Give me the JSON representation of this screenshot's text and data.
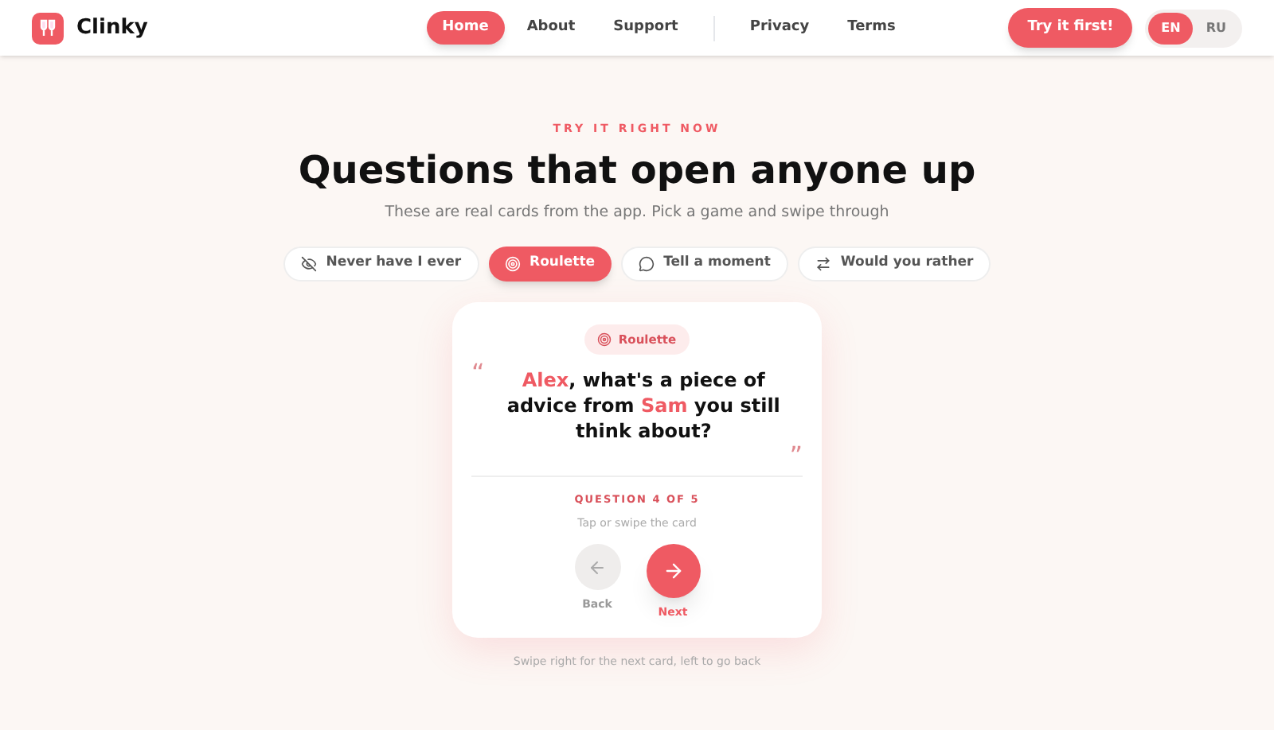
{
  "header": {
    "brand": "Clinky",
    "nav": [
      {
        "label": "Home",
        "selected": true
      },
      {
        "label": "About",
        "selected": false
      },
      {
        "label": "Support",
        "selected": false
      },
      {
        "label": "Privacy",
        "selected": false
      },
      {
        "label": "Terms",
        "selected": false
      }
    ],
    "cta": "Try it first!",
    "languages": [
      {
        "label": "EN",
        "selected": true
      },
      {
        "label": "RU",
        "selected": false
      }
    ]
  },
  "hero": {
    "eyebrow": "TRY IT RIGHT NOW",
    "title": "Questions that open anyone up",
    "subtitle": "These are real cards from the app. Pick a game and swipe through"
  },
  "games": [
    {
      "label": "Never have I ever",
      "kind": "eye-off",
      "selected": false
    },
    {
      "label": "Roulette",
      "kind": "target",
      "selected": true
    },
    {
      "label": "Tell a moment",
      "kind": "chat",
      "selected": false
    },
    {
      "label": "Would you rather",
      "kind": "swap",
      "selected": false
    }
  ],
  "card": {
    "badge": "Roulette",
    "open_quote": "“",
    "close_quote": "”",
    "question": [
      {
        "kind": "name",
        "text": "Alex"
      },
      {
        "kind": "text",
        "text": ", what's a piece of advice from "
      },
      {
        "kind": "name",
        "text": "Sam"
      },
      {
        "kind": "text",
        "text": " you still think about?"
      }
    ],
    "progress": "QUESTION 4 OF 5",
    "hint": "Tap or swipe the card",
    "back": {
      "label": "Back",
      "disabled": true
    },
    "next": {
      "label": "Next",
      "disabled": false
    }
  },
  "footer_hint": "Swipe right for the next card, left to go back"
}
